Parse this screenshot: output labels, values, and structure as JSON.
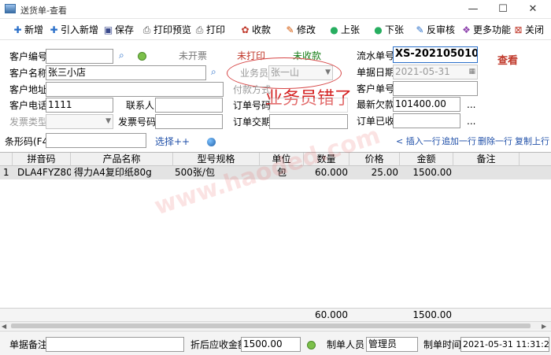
{
  "window": {
    "title": "送货单-查看",
    "minimize": "—",
    "maximize": "☐",
    "close": "✕"
  },
  "toolbar": [
    {
      "label": "新增",
      "icon": "✚",
      "color": "#2a6fc9"
    },
    {
      "label": "引入新增",
      "icon": "✚",
      "color": "#2a6fc9"
    },
    {
      "label": "保存",
      "icon": "▣",
      "color": "#3b4a8c"
    },
    {
      "label": "打印预览",
      "icon": "⎙",
      "color": "#555555"
    },
    {
      "label": "打印",
      "icon": "⎙",
      "color": "#555555"
    },
    {
      "label": "收款",
      "icon": "✿",
      "color": "#c0392b"
    },
    {
      "label": "修改",
      "icon": "✎",
      "color": "#d35400"
    },
    {
      "label": "上张",
      "icon": "●",
      "color": "#27ae60"
    },
    {
      "label": "下张",
      "icon": "●",
      "color": "#27ae60"
    },
    {
      "label": "反审核",
      "icon": "✎",
      "color": "#2a6fc9"
    },
    {
      "label": "更多功能",
      "icon": "❖",
      "color": "#8e44ad"
    },
    {
      "label": "关闭",
      "icon": "⊠",
      "color": "#c0392b"
    }
  ],
  "form": {
    "customer_code_label": "客户编号",
    "customer_code": "",
    "customer_name_label": "客户名称",
    "customer_name": "张三小店",
    "customer_addr_label": "客户地址",
    "customer_addr": "",
    "customer_phone_label": "客户电话",
    "customer_phone": "1111",
    "contact_label": "联系人",
    "contact": "",
    "invoice_type_label": "发票类型",
    "invoice_type": "",
    "invoice_no_label": "发票号码",
    "invoice_no": "",
    "status_invoice": "未开票",
    "status_print": "未打印",
    "status_pay": "未收款",
    "salesman_label": "业务员",
    "salesman": "张一山",
    "pay_method_label": "付款方式",
    "order_no_label": "订单号码",
    "order_no": "",
    "order_deposit_label": "订单交期",
    "order_deposit": "",
    "serial_label": "流水单号",
    "serial": "XS-202105010",
    "date_label": "单据日期",
    "date": "2021-05-31",
    "customer_order_label": "客户单号",
    "customer_order": "",
    "latest_owed_label": "最新欠款",
    "latest_owed": "101400.00",
    "order_received_label": "订单已收",
    "order_received": "",
    "more": "...",
    "view_tag": "查看",
    "annotation": "业务员错了"
  },
  "barcode": {
    "label": "条形码(F4)",
    "value": "",
    "select": "选择++",
    "insert_row": "< 插入一行",
    "append_row": "追加一行",
    "delete_row": "删除一行",
    "copy_row": "复制上行"
  },
  "table": {
    "headers": [
      "拼音码",
      "产品名称",
      "型号规格",
      "单位",
      "数量",
      "价格",
      "金额",
      "备注"
    ],
    "rows": [
      {
        "idx": "1",
        "pinyin": "DLA4FYZ80G",
        "name": "得力A4复印纸80g",
        "spec": "500张/包",
        "unit": "包",
        "qty": "60.000",
        "price": "25.00",
        "amount": "1500.00",
        "note": ""
      }
    ],
    "total_qty": "60.000",
    "total_amount": "1500.00"
  },
  "bottom": {
    "remark_label": "单据备注",
    "remark": "",
    "receivable_label": "折后应收金额",
    "receivable": "1500.00",
    "maker_label": "制单人员",
    "maker": "管理员",
    "make_time_label": "制单时间",
    "make_time": "2021-05-31 11:31:24"
  },
  "watermark": "www.haoded.com",
  "colors": {
    "status_red": "#c0392b",
    "status_green": "#1a7f1a",
    "status_gray": "#777777",
    "link_blue": "#1f4fa8"
  }
}
